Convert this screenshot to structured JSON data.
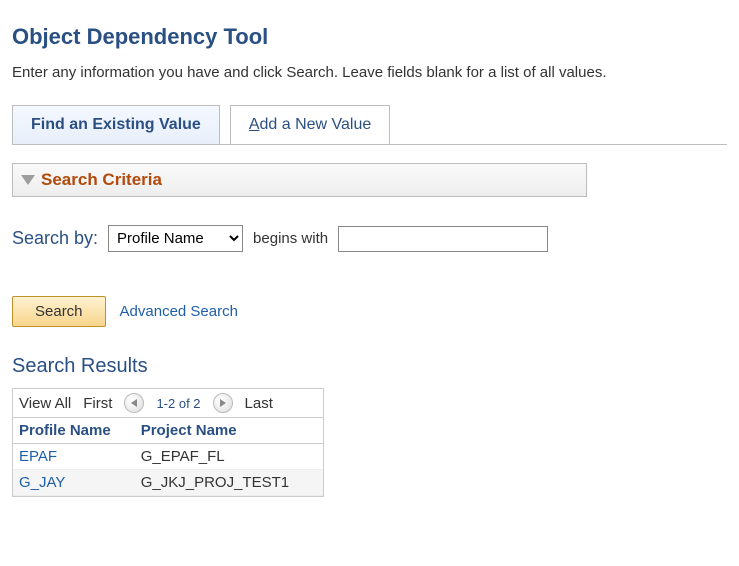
{
  "page": {
    "title": "Object Dependency Tool",
    "instructions": "Enter any information you have and click Search. Leave fields blank for a list of all values."
  },
  "tabs": {
    "active": "Find an Existing Value",
    "inactive_prefix": "A",
    "inactive_rest": "dd a New Value"
  },
  "search_section": {
    "header": "Search Criteria",
    "label": "Search by:",
    "field_selected": "Profile Name",
    "operator": "begins with",
    "value": ""
  },
  "actions": {
    "search": "Search",
    "advanced": "Advanced Search"
  },
  "results": {
    "title": "Search Results",
    "nav": {
      "view_all": "View All",
      "first": "First",
      "count": "1-2 of 2",
      "last": "Last"
    },
    "columns": {
      "profile": "Profile Name",
      "project": "Project Name"
    },
    "rows": [
      {
        "profile": "EPAF",
        "project": "G_EPAF_FL"
      },
      {
        "profile": "G_JAY",
        "project": "G_JKJ_PROJ_TEST1"
      }
    ]
  }
}
